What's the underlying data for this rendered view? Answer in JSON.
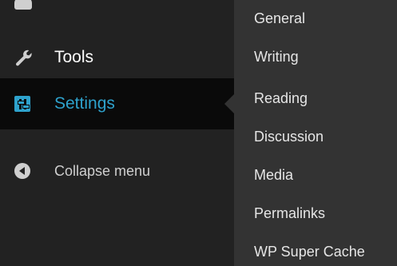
{
  "sidebar": {
    "items": [
      {
        "id": "partial",
        "label": "",
        "icon": "dashboard-icon"
      },
      {
        "id": "tools",
        "label": "Tools",
        "icon": "wrench-icon"
      },
      {
        "id": "settings",
        "label": "Settings",
        "icon": "sliders-icon",
        "active": true
      },
      {
        "id": "collapse",
        "label": "Collapse menu",
        "icon": "collapse-arrow-icon"
      }
    ]
  },
  "submenu": {
    "items": [
      {
        "label": "General"
      },
      {
        "label": "Writing"
      },
      {
        "label": "Reading"
      },
      {
        "label": "Discussion"
      },
      {
        "label": "Media"
      },
      {
        "label": "Permalinks"
      },
      {
        "label": "WP Super Cache"
      }
    ]
  },
  "colors": {
    "sidebar_bg": "#222222",
    "active_bg": "#0a0a0a",
    "accent": "#2ea2cc",
    "submenu_bg": "#333333",
    "text_light": "#e6e6e6"
  }
}
